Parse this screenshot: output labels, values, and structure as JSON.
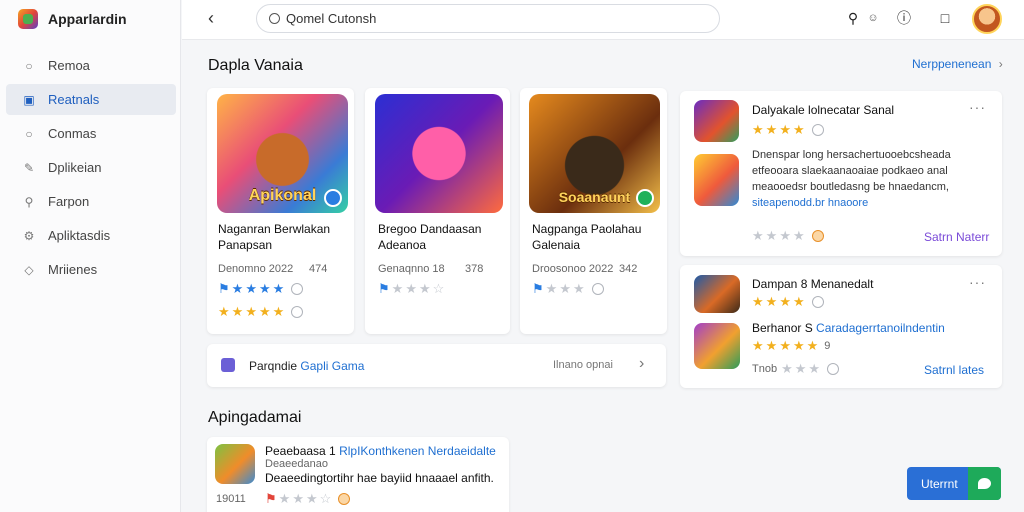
{
  "brand": {
    "name": "Apparlardin"
  },
  "sidebar": {
    "items": [
      {
        "label": "Remoa"
      },
      {
        "label": "Reatnals"
      },
      {
        "label": "Conmas"
      },
      {
        "label": "Dplikeian"
      },
      {
        "label": "Farpon"
      },
      {
        "label": "Apliktasdis"
      },
      {
        "label": "Mriienes"
      }
    ]
  },
  "topbar": {
    "search_value": "Qomel Cutonsh",
    "help_icon": "☺"
  },
  "featured": {
    "title": "Dapla Vanaia",
    "link": "Nerppenenean",
    "apps": [
      {
        "icon_text": "Apikonal",
        "name1": "Naganran Berwlakan",
        "name2": "Panapsan",
        "meta": "Denomno 2022",
        "meta2": "474",
        "rating_color": "blue",
        "stars": 4,
        "rating2": 5
      },
      {
        "icon_text": "",
        "name1": "Bregoo Dandaasan",
        "name2": "Adeanoa",
        "meta": "Genaqnno 18",
        "meta2": "378",
        "rating_color": "blue",
        "stars": 1
      },
      {
        "icon_text": "Soaanaunt",
        "name1": "Nagpanga Paolahau",
        "name2": "Galenaia",
        "meta": "Droosonoo 2022",
        "meta2": "342",
        "rating_color": "blue",
        "stars": 1
      }
    ]
  },
  "collection": {
    "label_a": "Parqndie",
    "label_b": "Gapli Gama",
    "right": "Ilnano opnai"
  },
  "side_card_1": {
    "title": "Dalyakale lolnecatar Sanal",
    "desc1": "Dnenspar long hersachertuooebcsheada",
    "desc2": "etfeooara  slaekaanaoaiae  podkaeo anal",
    "desc3": "meaooedsr boutledasng be hnaedancm,",
    "desc4": "siteapenodd.br hnaoore",
    "footer_link": "Satrn Naterr"
  },
  "side_card_2": {
    "title": "Dampan 8 Menanedalt",
    "title2": "Berhanor S",
    "title2b": "Caradagerrtanoilndentin",
    "rating_label": "9",
    "footer_left": "Tnob",
    "footer_link": "Satrnl lates"
  },
  "bottom": {
    "title": "Apingadamai",
    "line1a": "Peaebaasa 1",
    "line1b": "RlpIKonthkenen Nerdaeidalte",
    "line2": "Deaeedanao",
    "line3": "Deaeedingtortihr hae bayiid hnaaael anfith.",
    "count": "19011"
  },
  "actions": {
    "primary": "Uterrnt"
  }
}
